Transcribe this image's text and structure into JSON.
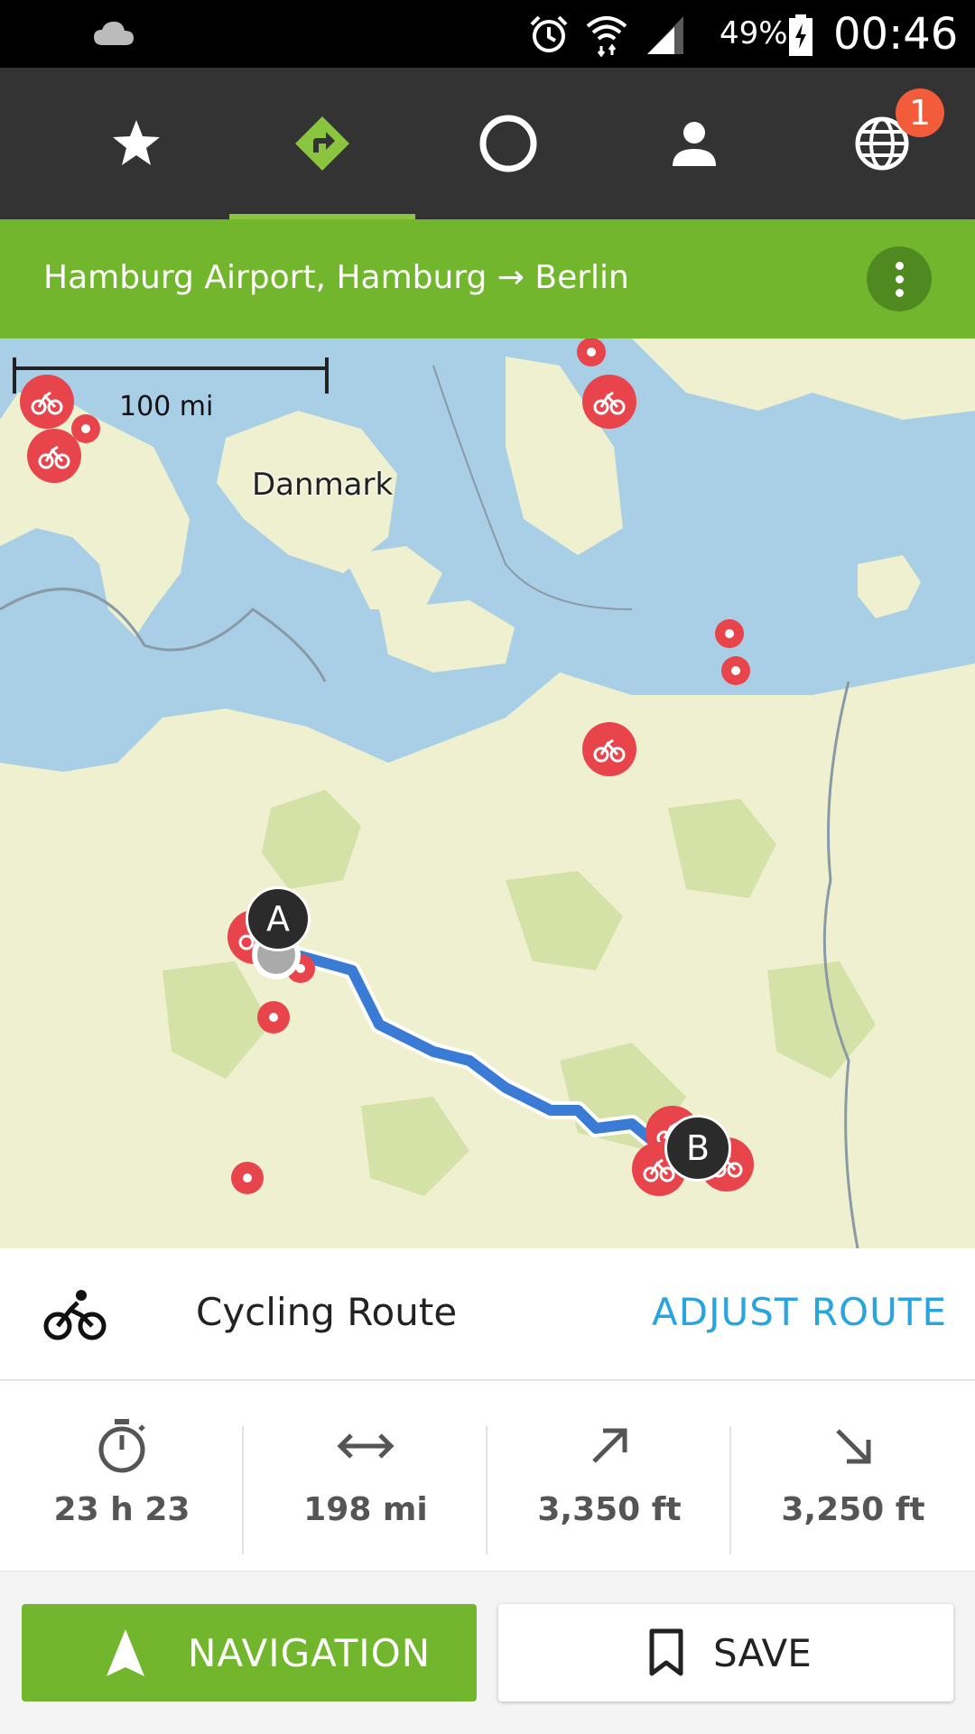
{
  "status_bar": {
    "battery": "49%",
    "time": "00:46",
    "icons": [
      "cloud-icon",
      "alarm-icon",
      "wifi-icon",
      "signal-icon",
      "battery-charging-icon"
    ]
  },
  "top_nav": {
    "tabs": [
      {
        "icon": "star-icon"
      },
      {
        "icon": "route-icon",
        "active": true
      },
      {
        "icon": "circle-icon"
      },
      {
        "icon": "person-icon"
      },
      {
        "icon": "globe-icon",
        "badge": "1"
      }
    ],
    "active_color": "#8bc53f",
    "badge_color": "#f35c3b"
  },
  "route_bar": {
    "title": "Hamburg Airport, Hamburg → Berlin",
    "menu_icon": "more-vert-icon"
  },
  "map": {
    "scale_label": "100 mi",
    "country_label": "Danmark",
    "start_marker": "A",
    "end_marker": "B",
    "route_color": "#3a7bd5"
  },
  "route_summary": {
    "icon": "bicycle-icon",
    "label": "Cycling Route",
    "adjust_label": "ADJUST ROUTE"
  },
  "stats": [
    {
      "icon": "stopwatch-icon",
      "value": "23 h 23"
    },
    {
      "icon": "distance-icon",
      "value": "198 mi"
    },
    {
      "icon": "ascent-icon",
      "value": "3,350 ft"
    },
    {
      "icon": "descent-icon",
      "value": "3,250 ft"
    }
  ],
  "actions": {
    "navigation_label": "NAVIGATION",
    "save_label": "SAVE"
  }
}
